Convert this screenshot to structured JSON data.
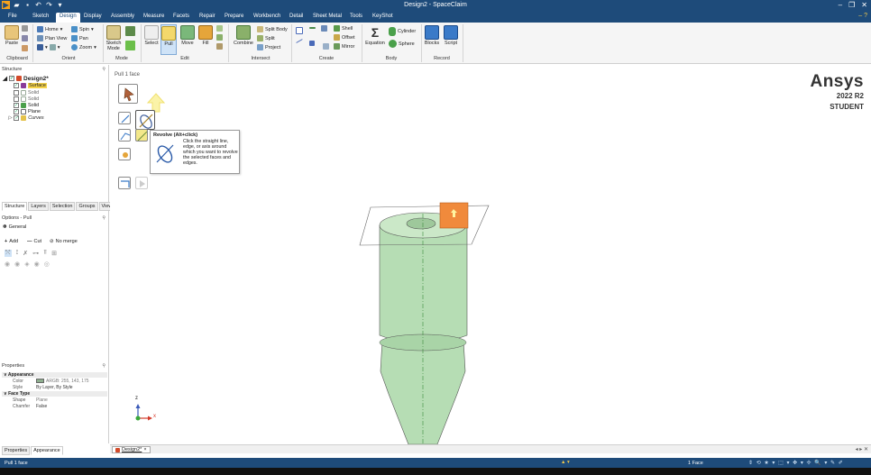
{
  "window": {
    "title": "Design2 - SpaceClaim"
  },
  "menu": {
    "tabs": [
      "File",
      "Sketch",
      "Design",
      "Display",
      "Assembly",
      "Measure",
      "Facets",
      "Repair",
      "Prepare",
      "Workbench",
      "Detail",
      "Sheet Metal",
      "Tools",
      "KeyShot"
    ],
    "active": "Design"
  },
  "ribbon": {
    "clipboard": {
      "paste": "Paste",
      "label": "Clipboard"
    },
    "orient": {
      "home": "Home",
      "spin": "Spin",
      "plan_view": "Plan View",
      "pan": "Pan",
      "zoom": "Zoom",
      "label": "Orient"
    },
    "mode": {
      "sketch_mode": "Sketch Mode",
      "label": "Mode"
    },
    "edit": {
      "select": "Select",
      "pull": "Pull",
      "move": "Move",
      "fill": "Fill",
      "label": "Edit"
    },
    "intersect": {
      "combine": "Combine",
      "split_body": "Split Body",
      "split": "Split",
      "project": "Project",
      "label": "Intersect"
    },
    "create": {
      "shell": "Shell",
      "offset": "Offset",
      "mirror": "Mirror",
      "label": "Create"
    },
    "body": {
      "equation": "Equation",
      "cylinder": "Cylinder",
      "sphere": "Sphere",
      "label": "Body"
    },
    "record": {
      "blocks": "Blocks",
      "script": "Script",
      "label": "Record"
    }
  },
  "structure": {
    "header": "Structure",
    "items": [
      {
        "label": "Design2*",
        "bold": true
      },
      {
        "label": "Surface",
        "highlight": true
      },
      {
        "label": "Solid"
      },
      {
        "label": "Solid"
      },
      {
        "label": "Solid"
      },
      {
        "label": "Plane"
      },
      {
        "label": "Curves",
        "italic": true
      }
    ],
    "tabs": [
      "Structure",
      "Layers",
      "Selection",
      "Groups",
      "Views"
    ]
  },
  "options": {
    "header": "Options - Pull",
    "general": "General",
    "add": "Add",
    "cut": "Cut",
    "no_merge": "No merge"
  },
  "properties": {
    "header": "Properties",
    "appearance": "Appearance",
    "color_label": "Color",
    "color_value": "ARGB: 255, 143, 175",
    "style_label": "Style",
    "style_value": "By Layer, By Style",
    "face_type": "Face Type",
    "shape_label": "Shape",
    "shape_value": "Plane",
    "chamfer_label": "Chamfer",
    "chamfer_value": "False",
    "tabs": [
      "Properties",
      "Appearance"
    ]
  },
  "viewport": {
    "hint": "Pull 1 face",
    "brand": "Ansys",
    "version": "2022 R2",
    "edition": "STUDENT",
    "axis_z": "z",
    "axis_x": "x"
  },
  "tooltip": {
    "title": "Revolve (Alt+click)",
    "body": "Click the straight line, edge, or axis around which you want to revolve the selected faces and edges."
  },
  "doc_tab": {
    "label": "Design2*"
  },
  "status": {
    "left": "Pull 1 face",
    "selection": "1 Face"
  },
  "colors": {
    "titlebar": "#1e4b7a",
    "model": "#b6ddb4",
    "selected_face": "#f08a3c"
  }
}
